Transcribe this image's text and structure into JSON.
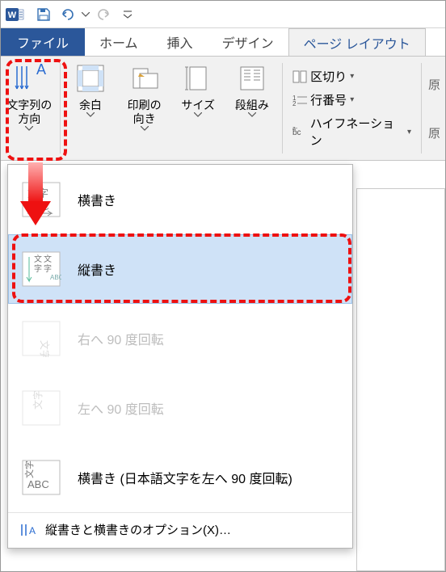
{
  "titlebar": {
    "app_name": "Word"
  },
  "tabs": {
    "file": "ファイル",
    "home": "ホーム",
    "insert": "挿入",
    "design": "デザイン",
    "layout": "ページ レイアウト"
  },
  "ribbon": {
    "text_direction": "文字列の\n方向",
    "margins": "余白",
    "orientation": "印刷の\n向き",
    "size": "サイズ",
    "columns": "段組み",
    "breaks": "区切り",
    "line_numbers": "行番号",
    "hyphenation": "ハイフネーション",
    "right_truncated_1": "原",
    "right_truncated_2": "原"
  },
  "dropdown": {
    "horizontal": "横書き",
    "vertical": "縦書き",
    "rotate_right": "右へ 90 度回転",
    "rotate_left": "左へ 90 度回転",
    "horizontal_jp_rotate": "横書き (日本語文字を左へ 90 度回転)",
    "options": "縦書きと横書きのオプション(X)…"
  },
  "colors": {
    "accent": "#2b579a",
    "highlight_red": "#e11",
    "hover_blue": "#cfe2f7"
  }
}
